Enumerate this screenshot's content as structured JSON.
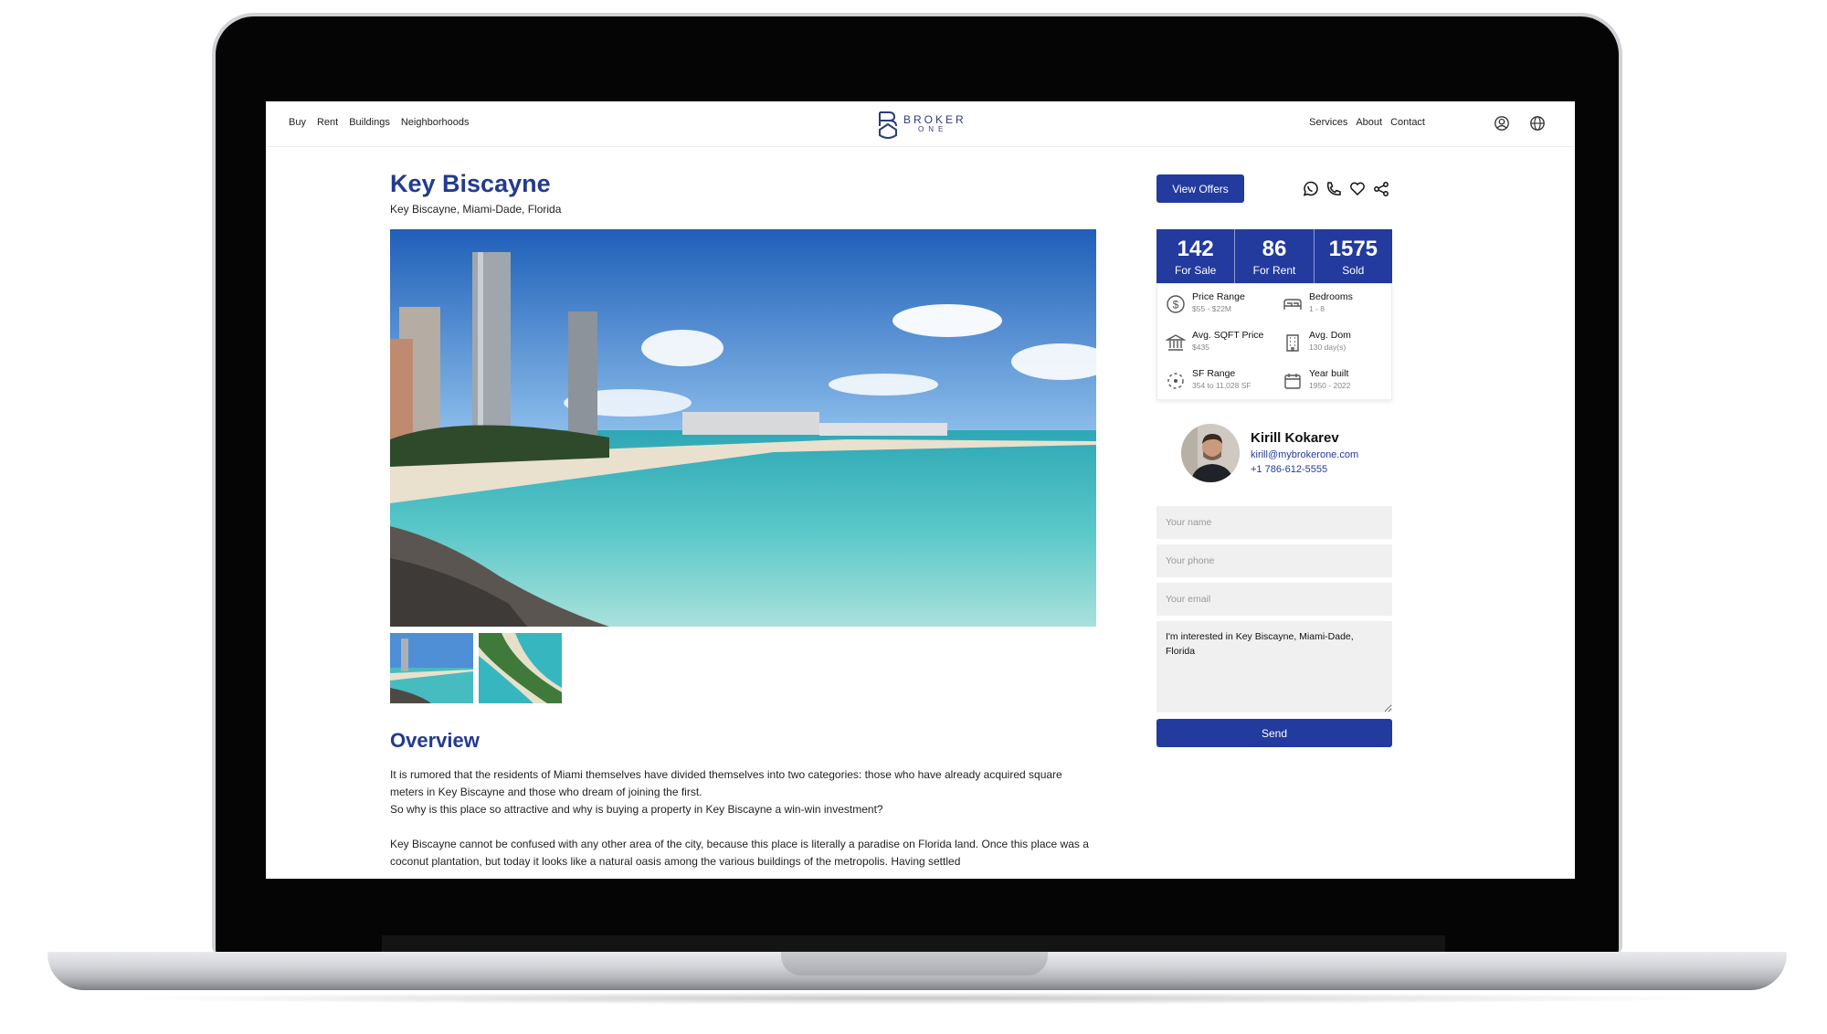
{
  "nav": {
    "left_links": [
      "Buy",
      "Rent",
      "Buildings",
      "Neighborhoods"
    ],
    "right_links": [
      "Services",
      "About",
      "Contact"
    ],
    "logo": {
      "line1": "BROKER",
      "line2": "ONE"
    }
  },
  "listing": {
    "title": "Key Biscayne",
    "subtitle": "Key Biscayne, Miami-Dade, Florida"
  },
  "overview": {
    "heading": "Overview",
    "paragraphs": [
      "It is rumored that the residents of Miami themselves have divided themselves into two categories: those who have already acquired square meters in Key Biscayne and those who dream of joining the first.",
      "So why is this place so attractive and why is buying a property in Key Biscayne a win-win investment?",
      "Key Biscayne cannot be confused with any other area of the city, because this place is literally a paradise on Florida land. Once this place was a coconut plantation, but today it looks like a natural oasis among the various buildings of the metropolis. Having settled"
    ]
  },
  "actions": {
    "view_offers": "View Offers",
    "icons": [
      "whatsapp-icon",
      "phone-icon",
      "heart-icon",
      "share-icon"
    ]
  },
  "stats": [
    {
      "value": "142",
      "label": "For Sale"
    },
    {
      "value": "86",
      "label": "For Rent"
    },
    {
      "value": "1575",
      "label": "Sold"
    }
  ],
  "info": [
    {
      "icon": "dollar-icon",
      "label": "Price Range",
      "value": "$55 - $22M"
    },
    {
      "icon": "bed-icon",
      "label": "Bedrooms",
      "value": "1 - 8"
    },
    {
      "icon": "bank-icon",
      "label": "Avg. SQFT Price",
      "value": "$435"
    },
    {
      "icon": "building-icon",
      "label": "Avg. Dom",
      "value": "130 day(s)"
    },
    {
      "icon": "area-icon",
      "label": "SF Range",
      "value": "354 to 11,028 SF"
    },
    {
      "icon": "calendar-icon",
      "label": "Year built",
      "value": "1950 - 2022"
    }
  ],
  "agent": {
    "name": "Kirill Kokarev",
    "email": "kirill@mybrokerone.com",
    "phone": "+1 786-612-5555"
  },
  "form": {
    "name_placeholder": "Your name",
    "phone_placeholder": "Your phone",
    "email_placeholder": "Your email",
    "message": "I'm interested in Key Biscayne, Miami-Dade, Florida",
    "send": "Send"
  },
  "colors": {
    "accent": "#233a9e",
    "heading": "#233a8e"
  }
}
